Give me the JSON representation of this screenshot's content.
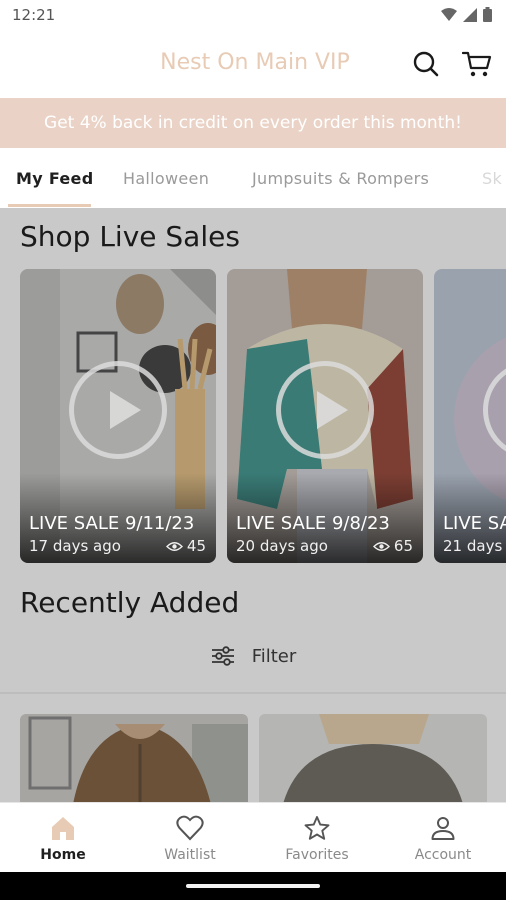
{
  "status_bar": {
    "time": "12:21"
  },
  "header": {
    "title": "Nest On Main VIP",
    "search_icon": "search-icon",
    "cart_icon": "cart-icon",
    "title_color": "#e8cbb5"
  },
  "promo": {
    "text": "Get 4% back in credit on every order this month!",
    "bg_color": "#ead3c6"
  },
  "tabs": [
    {
      "label": "My Feed",
      "active": true
    },
    {
      "label": "Halloween",
      "active": false
    },
    {
      "label": "Jumpsuits & Rompers",
      "active": false
    },
    {
      "label": "Sk",
      "active": false
    }
  ],
  "live_section": {
    "title": "Shop Live Sales",
    "cards": [
      {
        "title": "LIVE SALE 9/11/23",
        "age": "17 days ago",
        "views": "45"
      },
      {
        "title": "LIVE SALE 9/8/23",
        "age": "20 days ago",
        "views": "65"
      },
      {
        "title": "LIVE SA",
        "age": "21 days"
      }
    ]
  },
  "recent_section": {
    "title": "Recently Added",
    "filter_label": "Filter"
  },
  "bottom_nav": [
    {
      "label": "Home",
      "icon": "home-icon",
      "active": true
    },
    {
      "label": "Waitlist",
      "icon": "heart-icon",
      "active": false
    },
    {
      "label": "Favorites",
      "icon": "star-icon",
      "active": false
    },
    {
      "label": "Account",
      "icon": "account-icon",
      "active": false
    }
  ]
}
